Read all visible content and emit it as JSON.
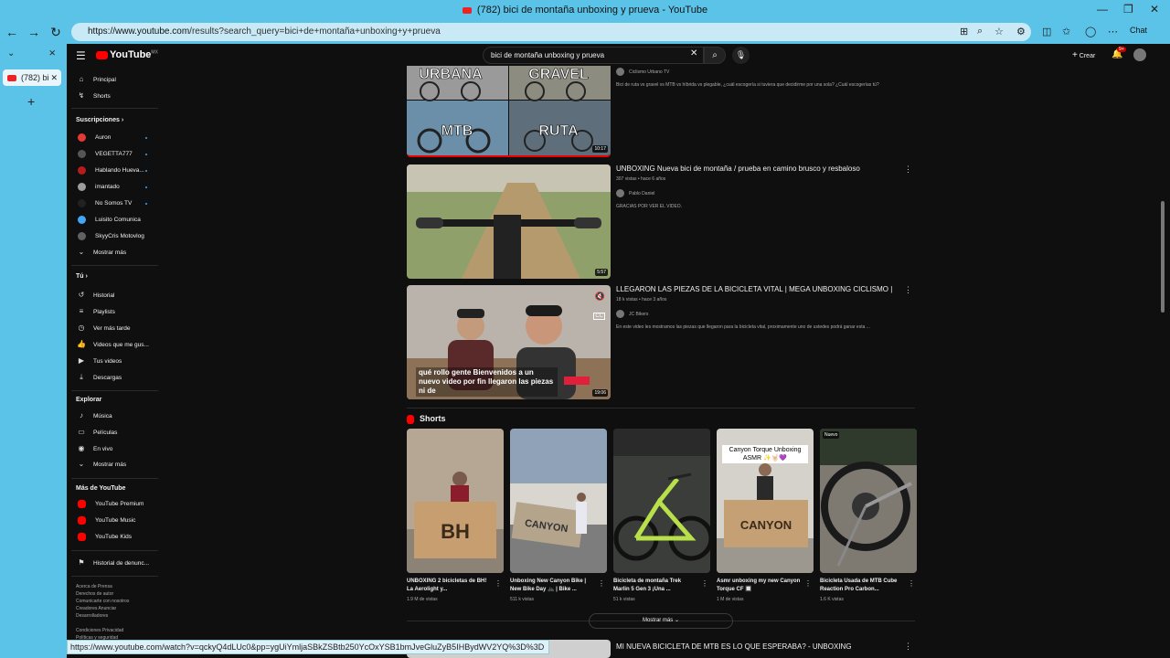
{
  "browser": {
    "window_title": "(782) bici de montaña unboxing y prueva - YouTube",
    "url_host": "https://www.youtube.com",
    "url_path": "/results?search_query=bici+de+montaña+unboxing+y+prueva",
    "chat_label": "Chat",
    "tab_label": "(782) bi",
    "status_url": "https://www.youtube.com/watch?v=qckyQ4dLUc0&pp=ygUiYmljaSBkZSBtb250YcOxYSB1bmJveGluZyB5IHBydWV2YQ%3D%3D"
  },
  "masthead": {
    "logo": "YouTube",
    "logo_region": "MX",
    "search_value": "bici de montaña unboxing y prueva",
    "create_label": "Crear",
    "notif_count": "9+"
  },
  "sidebar": {
    "main": [
      {
        "label": "Principal",
        "icon": "home-icon",
        "glyph": "⌂"
      },
      {
        "label": "Shorts",
        "icon": "shorts-icon",
        "glyph": "↯"
      }
    ],
    "subs_title": "Suscripciones",
    "subs": [
      {
        "label": "Auron",
        "color": "#e53935",
        "dot": true
      },
      {
        "label": "VEGETTA777",
        "color": "#555555",
        "dot": true
      },
      {
        "label": "Hablando Hueva...",
        "color": "#b71c1c",
        "dot": true
      },
      {
        "label": "imantado",
        "color": "#9e9e9e",
        "dot": true
      },
      {
        "label": "No Somos TV",
        "color": "#212121",
        "dot": true
      },
      {
        "label": "Luisito Comunica",
        "color": "#42a5f5",
        "dot": false
      },
      {
        "label": "SkyyCris Motovlog",
        "color": "#616161",
        "dot": false
      }
    ],
    "subs_more": "Mostrar más",
    "you_title": "Tú",
    "you": [
      {
        "label": "Historial",
        "glyph": "↺"
      },
      {
        "label": "Playlists",
        "glyph": "≡"
      },
      {
        "label": "Ver más tarde",
        "glyph": "◷"
      },
      {
        "label": "Videos que me gus...",
        "glyph": "👍"
      },
      {
        "label": "Tus videos",
        "glyph": "▶"
      },
      {
        "label": "Descargas",
        "glyph": "⤓"
      }
    ],
    "explore_title": "Explorar",
    "explore": [
      {
        "label": "Música",
        "glyph": "♪"
      },
      {
        "label": "Películas",
        "glyph": "▭"
      },
      {
        "label": "En vivo",
        "glyph": "◉"
      }
    ],
    "explore_more": "Mostrar más",
    "more_title": "Más de YouTube",
    "more": [
      {
        "label": "YouTube Premium"
      },
      {
        "label": "YouTube Music"
      },
      {
        "label": "YouTube Kids"
      }
    ],
    "report": "Historial de denunc...",
    "footer": [
      "Acerca de  Prensa",
      "Derechos de autor",
      "Comunicarte con nosotros",
      "Creadores  Anunciar",
      "Desarrolladores",
      "",
      "Condiciones  Privacidad",
      "Políticas y seguridad"
    ]
  },
  "videos": [
    {
      "title": "",
      "thumb_words": [
        "URBANA",
        "GRAVEL",
        "MTB",
        "RUTA"
      ],
      "duration": "10:17",
      "meta": "",
      "channel": "Ciclismo Urbano TV",
      "desc": "Bici de ruta vs gravel vs MTB vs híbrida vs plegable, ¿cuál escogería si tuviera que decidirme por una sola? ¿Cuál escogerías tú?"
    },
    {
      "title": "UNBOXING Nueva bici de montaña / prueba en camino brusco y resbaloso",
      "duration": "5:57",
      "meta": "307 vistas • hace 6 años",
      "channel": "Pablo Daniel",
      "desc": "GRACIAS POR VER EL VIDEO."
    },
    {
      "title": "LLEGARON LAS PIEZAS DE LA BICICLETA VITAL | MEGA UNBOXING CICLISMO |",
      "duration": "19:06",
      "meta": "18 k vistas • hace 3 años",
      "channel": "JC Bikers",
      "desc": "En este video les mostramos las piezas que llegaron para la bicicleta vital, proximamente uno de ustedes podrá ganar esta ...",
      "caption": "qué rollo gente Bienvenidos a un nuevo video por fin llegaron las piezas ni de"
    },
    {
      "title": "MI NUEVA BICICLETA DE MTB ES LO QUE ESPERABA? - UNBOXING"
    }
  ],
  "shorts_title": "Shorts",
  "shorts": [
    {
      "title": "UNBOXING 2 bicicletas de BH! La Aerolight y...",
      "views": "1.9 M de vistas",
      "box_text": "BH",
      "overlay": ""
    },
    {
      "title": "Unboxing New Canyon Bike | New Bike Day 🚲 | Bike ...",
      "views": "511 k vistas",
      "box_text": "CANYON",
      "overlay": ""
    },
    {
      "title": "Bicicleta de montaña Trek Marlin 5 Gen 3 ¡Una ...",
      "views": "51 k vistas",
      "box_text": "",
      "overlay": ""
    },
    {
      "title": "Asmr unboxing my new Canyon Torque CF 🔲",
      "views": "1 M de vistas",
      "box_text": "CANYON",
      "overlay": "Canyon Torque Unboxing ASMR ✨🤘🏻💜"
    },
    {
      "title": "Bicicleta Usada de MTB Cube Reaction Pro Carbon...",
      "views": "1.6 K vistas",
      "box_text": "",
      "overlay": "",
      "badge": "Nuevo"
    }
  ],
  "shorts_more": "Mostrar más"
}
